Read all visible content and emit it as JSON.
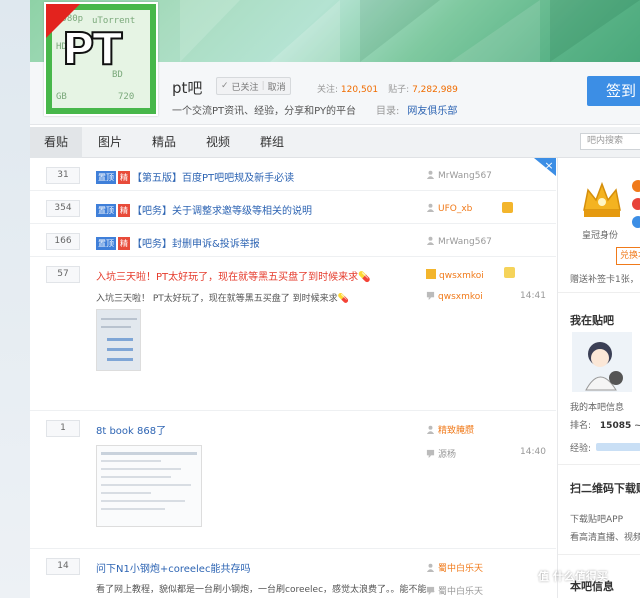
{
  "forum": {
    "logo_text": "PT",
    "name": "pt吧",
    "follow_status": "已关注",
    "unfollow": "取消",
    "follow_label": "关注:",
    "follow_count": "120,501",
    "posts_label": "贴子:",
    "posts_count": "7,282,989",
    "slogan": "一个交流PT资讯、经验，分享和PY的平台",
    "catalog_label": "目录:",
    "catalog_value": "网友俱乐部",
    "sign_label": "签到"
  },
  "tabs": [
    "看贴",
    "图片",
    "精品",
    "视频",
    "群组"
  ],
  "search": {
    "placeholder": "吧内搜索"
  },
  "close_label": "×",
  "threads": [
    {
      "replies": "31",
      "badges": [
        "置顶",
        "精"
      ],
      "title": "【第五版】百度PT吧吧规及新手必读",
      "author": "MrWang567"
    },
    {
      "replies": "354",
      "badges": [
        "置顶",
        "精"
      ],
      "title": "【吧务】关于调整求邀等级等相关的说明",
      "author": "UFO_xb"
    },
    {
      "replies": "166",
      "badges": [
        "置顶",
        "精"
      ],
      "title": "【吧务】封删申诉&投诉举报",
      "author": "MrWang567"
    },
    {
      "replies": "57",
      "title": "入坑三天啦！PT太好玩了，现在就等黑五买盘了到时候来求",
      "author": "qwsxmkoi",
      "abstract": "入坑三天啦！ PT太好玩了，现在就等黑五买盘了 到时候来求",
      "last_author": "qwsxmkoi",
      "time": "14:41"
    },
    {
      "replies": "1",
      "title": "8t book 868了",
      "author": "精致腌臜",
      "last_author": "源杨",
      "time": "14:40"
    },
    {
      "replies": "14",
      "title": "问下N1小钢炮+coreelec能共存吗",
      "author": "蜀中白乐天",
      "abstract": "看了网上教程，貌似都是一台刷小钢炮，一台刷coreelec，感觉太浪费了。。能不能...",
      "last_author": "蜀中白乐天"
    }
  ],
  "sidebar": {
    "crown_label": "皇冠身份",
    "exchange": "兑换本",
    "gift": "赠送补签卡1张，",
    "my_forum": "我在贴吧",
    "my_info": "我的本吧信息",
    "rank_label": "排名:",
    "rank_value": "15085",
    "exp_label": "经验:",
    "qr_title": "扫二维码下载贴",
    "download": "下载贴吧APP",
    "live": "看高清直播、视频",
    "bottom": "本吧信息"
  },
  "watermark": "值 什么值得买",
  "colors": {
    "accent": "#3c8ee5",
    "link": "#2d64b3",
    "hot": "#e84b3a",
    "top": "#3f7fd9",
    "orange": "#f06c00"
  }
}
